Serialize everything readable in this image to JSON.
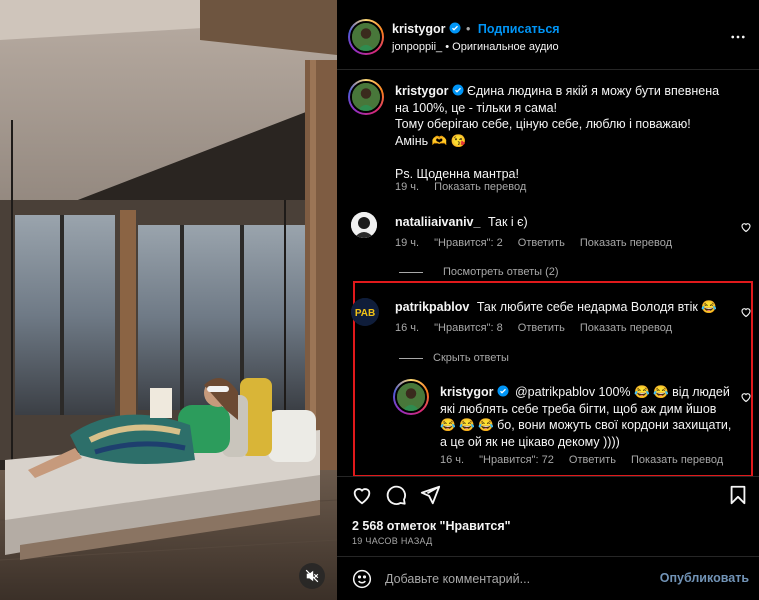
{
  "post": {
    "author": "kristygor",
    "follow_label": "Подписаться",
    "separator": "•",
    "audio_user": "jonpoppii_",
    "audio_label": "Оригинальное аудио"
  },
  "caption": {
    "author": "kristygor",
    "line1": "Єдина людина в якій я можу бути впевнена на 100%, це - тільки я сама!",
    "line2": "Тому оберігаю себе, ціную себе, люблю і поважаю!",
    "line3": "Амінь 🫶 😘",
    "line4": "Ps. Щоденна мантра!",
    "time": "19 ч.",
    "translate": "Показать перевод"
  },
  "comments": [
    {
      "user": "nataliiaivaniv_",
      "text": "Так і є)",
      "time": "19 ч.",
      "likes": "\"Нравится\": 2",
      "reply": "Ответить",
      "translate": "Показать перевод",
      "toggle": "Посмотреть ответы (2)"
    },
    {
      "user": "patrikpablov",
      "text": "Так любите себе недарма Володя втік 😂",
      "time": "16 ч.",
      "likes": "\"Нравится\": 8",
      "reply": "Ответить",
      "translate": "Показать перевод",
      "toggle": "Скрыть ответы"
    }
  ],
  "reply": {
    "user": "kristygor",
    "text": "@patrikpablov 100% 😂 😂 від людей які люблять себе треба бігти, щоб аж дим йшов 😂 😂 😂 бо, вони можуть свої кордони захищати, а це ой як не цікаво декому ))))",
    "time": "16 ч.",
    "likes": "\"Нравится\": 72",
    "reply_label": "Ответить",
    "translate": "Показать перевод"
  },
  "stats": {
    "likes": "2 568 отметок \"Нравится\"",
    "date": "19 ЧАСОВ НАЗАД"
  },
  "composer": {
    "placeholder": "Добавьте комментарий...",
    "publish": "Опубликовать"
  },
  "icons": {
    "like": "heart-icon",
    "comment": "comment-icon",
    "share": "share-icon",
    "save": "bookmark-icon",
    "more": "more-icon",
    "emoji": "smile-icon",
    "mute": "mute-icon",
    "verified": "verified-badge-icon"
  },
  "colors": {
    "accent": "#0095f6",
    "highlight": "#e0191b",
    "muted": "#a8a8a8",
    "publish": "#7193b6"
  }
}
